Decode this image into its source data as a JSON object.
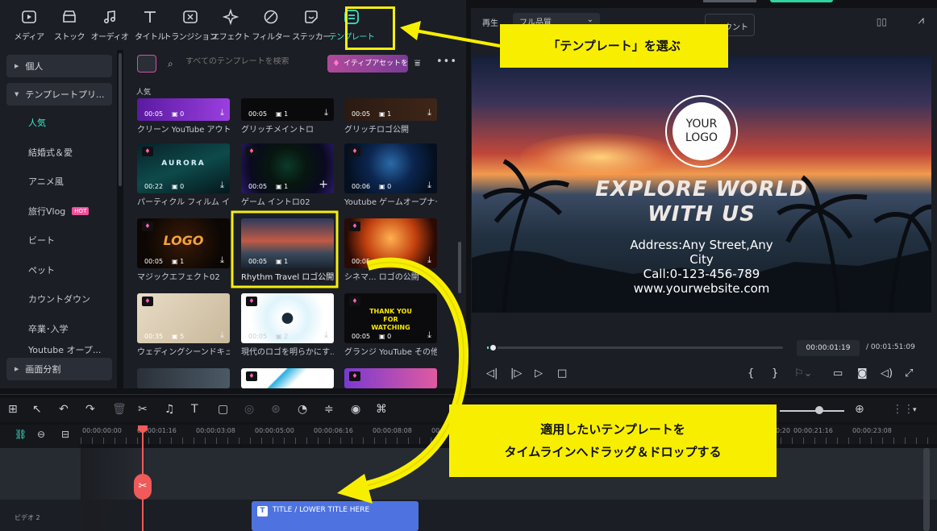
{
  "toolbar": {
    "items": [
      {
        "label": "メディア",
        "icon": "media-icon"
      },
      {
        "label": "ストック",
        "icon": "stock-icon"
      },
      {
        "label": "オーディオ",
        "icon": "music-note-icon"
      },
      {
        "label": "タイトル",
        "icon": "title-t-icon"
      },
      {
        "label": "トランジション",
        "icon": "transition-icon"
      },
      {
        "label": "エフェクト",
        "icon": "effect-sparkle-icon"
      },
      {
        "label": "フィルター",
        "icon": "filter-icon"
      },
      {
        "label": "ステッカー",
        "icon": "sticker-icon"
      },
      {
        "label": "テンプレート",
        "icon": "template-icon"
      }
    ],
    "active": "テンプレート"
  },
  "sidebar": {
    "group_personal": "個人",
    "group_templates": "テンプレートプリ...",
    "items": [
      {
        "label": "人気"
      },
      {
        "label": "結婚式＆愛"
      },
      {
        "label": "アニメ風"
      },
      {
        "label": "旅行Vlog",
        "badge": "HOT"
      },
      {
        "label": "ビート"
      },
      {
        "label": "ペット"
      },
      {
        "label": "カウントダウン"
      },
      {
        "label": "卒業･入学"
      },
      {
        "label": "Youtube オープ..."
      }
    ],
    "group_split": "画面分割"
  },
  "gallery": {
    "search_placeholder": "すべてのテンプレートを検索",
    "creative_assets": "イティブアセットを",
    "section": "人気",
    "cards": [
      {
        "caption": "クリーン YouTube アウト...",
        "duration": "00:05",
        "count": "0"
      },
      {
        "caption": "グリッチメイントロ",
        "duration": "00:05",
        "count": "1"
      },
      {
        "caption": "グリッチロゴ公開",
        "duration": "00:05",
        "count": "1"
      },
      {
        "caption": "パーティクル フィルム イン...",
        "duration": "00:22",
        "count": "0",
        "title": "AURORA"
      },
      {
        "caption": "ゲーム イントロ02",
        "duration": "00:05",
        "count": "1"
      },
      {
        "caption": "Youtube ゲームオープナー...",
        "duration": "00:06",
        "count": "0"
      },
      {
        "caption": "マジックエフェクト02",
        "duration": "00:05",
        "count": "1",
        "title": "LOGO"
      },
      {
        "caption": "Rhythm Travel ロゴ公開",
        "duration": "00:05",
        "count": "1"
      },
      {
        "caption": "シネマ... ロゴの公開",
        "duration": "00:05",
        "count": "1"
      },
      {
        "caption": "ウェディングシーンドキュメ...",
        "duration": "00:35",
        "count": "5"
      },
      {
        "caption": "現代のロゴを明らかにす...",
        "duration": "00:05",
        "count": "2"
      },
      {
        "caption": "グランジ YouTube その他",
        "duration": "00:05",
        "count": "0",
        "title": "THANK YOU FOR WATCHING"
      }
    ]
  },
  "preview": {
    "label": "再生",
    "quality": "フル品質",
    "tooltip": "ウント",
    "logo_text": "YOUR LOGO",
    "headline": "EXPLORE WORLD WITH US",
    "address": "Address:Any Street,Any City",
    "call": "Call:0-123-456-789",
    "website": "www.yourwebsite.com",
    "current_time": "00:00:01:19",
    "total_time": "/  00:01:51:09",
    "progress": 0.02
  },
  "timeline": {
    "ruler": [
      "00:00:00:00",
      "00:00:01:16",
      "00:00:03:08",
      "00:00:05:00",
      "00:00:06:16",
      "00:00:08:08",
      "00:00:10:0",
      "",
      "",
      "",
      "",
      "",
      "0:20",
      "00:00:21:16",
      "00:00:23:08"
    ],
    "track_label": "ビデオ 2",
    "clip_label": "TITLE / LOWER TITLE HERE"
  },
  "annotations": {
    "pick_template": "「テンプレート」を選ぶ",
    "drag_line1": "適用したいテンプレートを",
    "drag_line2": "タイムラインへドラッグ＆ドロップする",
    "color": "#f8ef00"
  }
}
